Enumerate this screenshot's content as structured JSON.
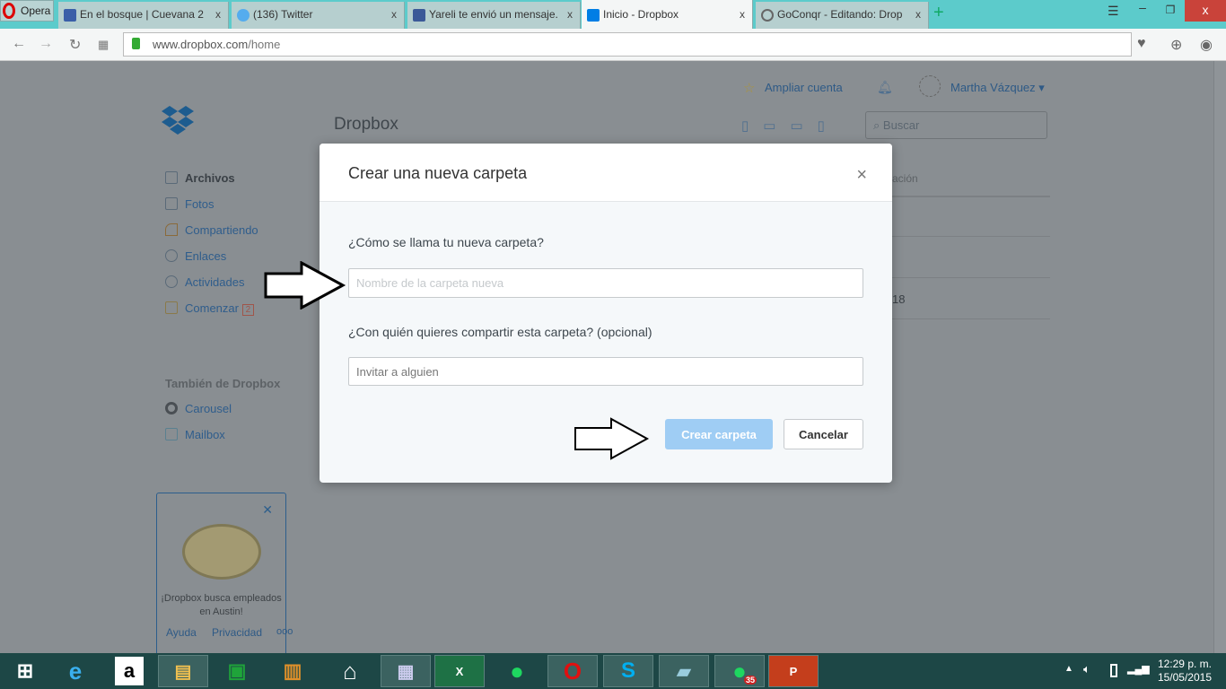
{
  "browser": {
    "menu_label": "Opera",
    "tabs": [
      {
        "title": "En el bosque | Cuevana 2",
        "color": "#3a5fa8"
      },
      {
        "title": "(136) Twitter",
        "color": "#55acee"
      },
      {
        "title": "Yareli te envió un mensaje.",
        "color": "#3b5998"
      },
      {
        "title": "Inicio - Dropbox",
        "color": "#007ee5",
        "active": true
      },
      {
        "title": "GoConqr - Editando: Drop",
        "color": "#666"
      }
    ],
    "url_host": "www.dropbox.com",
    "url_path": "/home",
    "close_tab": "x"
  },
  "header": {
    "upgrade": "Ampliar cuenta",
    "user": "Martha Vázquez",
    "title": "Dropbox",
    "search_placeholder": "Buscar"
  },
  "sidebar": {
    "items": [
      {
        "label": "Archivos"
      },
      {
        "label": "Fotos"
      },
      {
        "label": "Compartiendo"
      },
      {
        "label": "Enlaces"
      },
      {
        "label": "Actividades"
      },
      {
        "label": "Comenzar",
        "badge": "2"
      }
    ],
    "also_title": "También de Dropbox",
    "also": [
      {
        "label": "Carousel"
      },
      {
        "label": "Mailbox"
      }
    ],
    "promo": "¡Dropbox busca empleados en Austin!",
    "footer": [
      "Ayuda",
      "Privacidad",
      "ooo"
    ]
  },
  "background_table": {
    "col_fragment": "ación",
    "cell_fragment": "18"
  },
  "modal": {
    "title": "Crear una nueva carpeta",
    "close": "×",
    "name_label": "¿Cómo se llama tu nueva carpeta?",
    "name_placeholder": "Nombre de la carpeta nueva",
    "share_label": "¿Con quién quieres compartir esta carpeta? (opcional)",
    "share_placeholder": "Invitar a alguien",
    "create": "Crear carpeta",
    "cancel": "Cancelar"
  },
  "taskbar": {
    "time": "12:29 p. m.",
    "date": "15/05/2015",
    "spotify_badge": "35"
  }
}
